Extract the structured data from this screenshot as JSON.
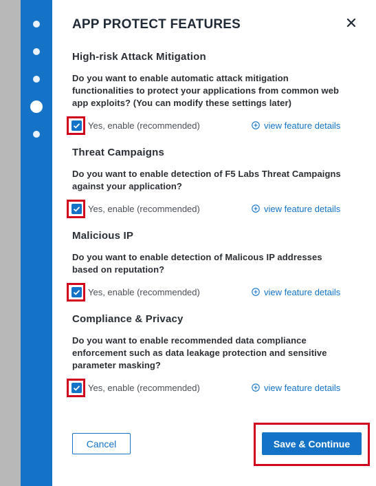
{
  "panel": {
    "title": "APP PROTECT FEATURES",
    "close_icon": "close-icon"
  },
  "stepper": {
    "steps": [
      {
        "state": "inactive"
      },
      {
        "state": "inactive"
      },
      {
        "state": "inactive"
      },
      {
        "state": "current"
      },
      {
        "state": "inactive"
      }
    ]
  },
  "sections": [
    {
      "title": "High-risk Attack Mitigation",
      "question_lines": [
        "Do you want to enable automatic attack mitigation",
        "functionalities to protect your applications from common web",
        "app exploits? (You can modify these settings later)"
      ],
      "checkbox_label": "Yes, enable (recommended)",
      "checked": true,
      "link_label": "view feature details"
    },
    {
      "title": "Threat Campaigns",
      "question_lines": [
        "Do you want to enable detection of F5 Labs Threat Campaigns",
        "against your application?"
      ],
      "checkbox_label": "Yes, enable (recommended)",
      "checked": true,
      "link_label": "view feature details"
    },
    {
      "title": "Malicious IP",
      "question_lines": [
        "Do you want to enable detection of Malicous IP addresses",
        "based on reputation?"
      ],
      "checkbox_label": "Yes, enable (recommended)",
      "checked": true,
      "link_label": "view feature details"
    },
    {
      "title": "Compliance & Privacy",
      "question_lines": [
        "Do you want to enable recommended data compliance",
        "enforcement such as data leakage protection and sensitive",
        "parameter masking?"
      ],
      "checkbox_label": "Yes, enable (recommended)",
      "checked": true,
      "link_label": "view feature details"
    }
  ],
  "footer": {
    "cancel_label": "Cancel",
    "save_label": "Save & Continue"
  },
  "colors": {
    "accent": "#1473c7",
    "highlight": "#d0021b"
  }
}
